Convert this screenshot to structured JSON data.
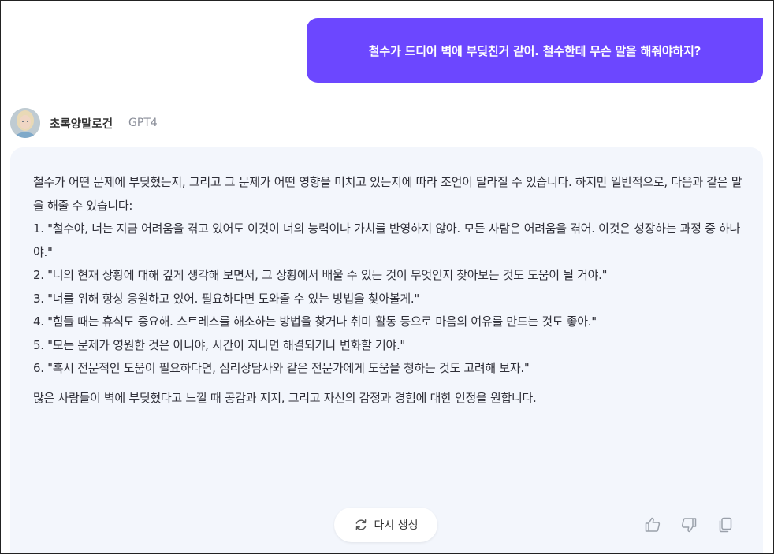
{
  "user_message": {
    "text": "철수가 드디어 벽에 부딪친거 같어. 철수한테 무슨 말을 해줘야하지?"
  },
  "bot": {
    "name": "초록양말로건",
    "model": "GPT4",
    "avatar_icon": "portrait-avatar"
  },
  "response": {
    "intro": "철수가 어떤 문제에 부딪혔는지, 그리고 그 문제가 어떤 영향을 미치고 있는지에 따라 조언이 달라질 수 있습니다. 하지만 일반적으로, 다음과 같은 말을 해줄 수 있습니다:",
    "items": [
      "1. \"철수야, 너는 지금 어려움을 겪고 있어도 이것이 너의 능력이나 가치를 반영하지 않아. 모든 사람은 어려움을 겪어. 이것은 성장하는 과정 중 하나야.\"",
      "2. \"너의 현재 상황에 대해 깊게 생각해 보면서, 그 상황에서 배울 수 있는 것이 무엇인지 찾아보는 것도 도움이 될 거야.\"",
      "3. \"너를 위해 항상 응원하고 있어. 필요하다면 도와줄 수 있는 방법을 찾아볼게.\"",
      "4. \"힘들 때는 휴식도 중요해. 스트레스를 해소하는 방법을 찾거나 취미 활동 등으로 마음의 여유를 만드는 것도 좋아.\"",
      "5. \"모든 문제가 영원한 것은 아니야, 시간이 지나면 해결되거나 변화할 거야.\"",
      "6. \"혹시 전문적인 도움이 필요하다면, 심리상담사와 같은 전문가에게 도움을 청하는 것도 고려해 보자.\""
    ],
    "closing": "많은 사람들이 벽에 부딪혔다고 느낄 때 공감과 지지, 그리고 자신의 감정과 경험에 대한 인정을 원합니다."
  },
  "controls": {
    "regenerate_label": "다시 생성",
    "regenerate_icon": "refresh-icon",
    "thumbs_up_icon": "thumbs-up-icon",
    "thumbs_down_icon": "thumbs-down-icon",
    "copy_icon": "copy-icon"
  },
  "colors": {
    "user_bubble": "#6c47ff",
    "bot_card": "#f3f6fc",
    "icon": "#9aa0aa"
  }
}
